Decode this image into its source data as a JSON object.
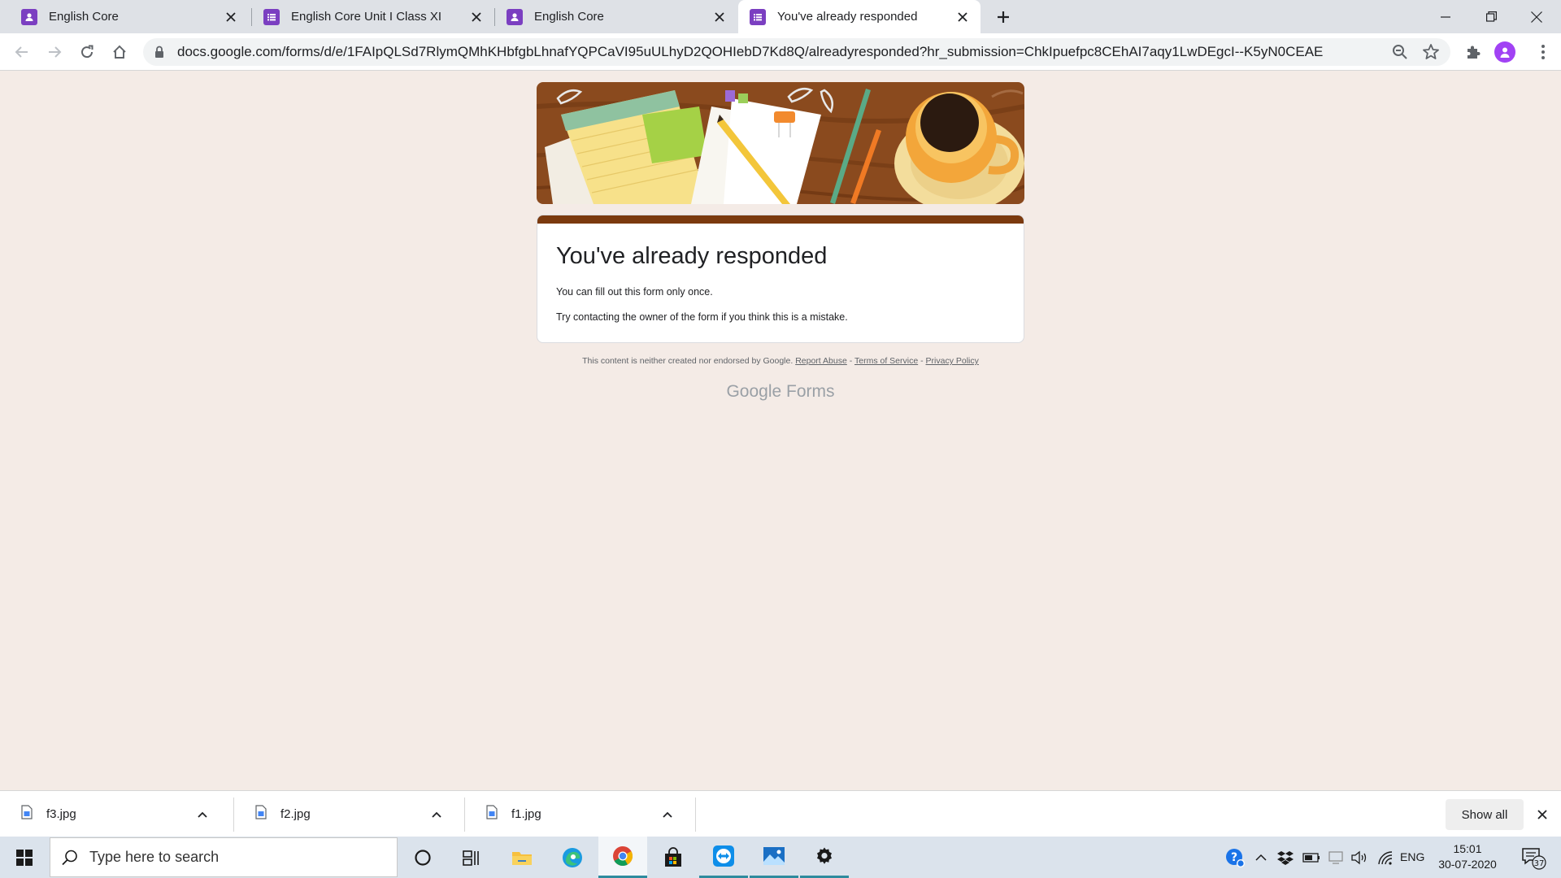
{
  "browser": {
    "tabs": [
      {
        "title": "English Core",
        "icon": "google-classroom-icon"
      },
      {
        "title": "English Core Unit I Class XI",
        "icon": "google-forms-icon"
      },
      {
        "title": "English Core",
        "icon": "google-classroom-icon"
      },
      {
        "title": "You've already responded",
        "icon": "google-forms-icon",
        "active": true
      }
    ],
    "url": "docs.google.com/forms/d/e/1FAIpQLSd7RlymQMhKHbfgbLhnafYQPCaVI95uULhyD2QOHIebD7Kd8Q/alreadyresponded?hr_submission=ChkIpuefpc8CEhAI7aqy1LwDEgcI--K5yN0CEAE"
  },
  "form": {
    "heading": "You've already responded",
    "line1": "You can fill out this form only once.",
    "line2": "Try contacting the owner of the form if you think this is a mistake.",
    "accent_color": "#7b3a0e"
  },
  "footer": {
    "disclaimer": "This content is neither created nor endorsed by Google.",
    "report_abuse": "Report Abuse",
    "sep": " - ",
    "terms": "Terms of Service",
    "privacy": "Privacy Policy",
    "brand_google": "Google",
    "brand_forms": "Forms"
  },
  "downloads": {
    "items": [
      {
        "name": "f3.jpg"
      },
      {
        "name": "f2.jpg"
      },
      {
        "name": "f1.jpg"
      }
    ],
    "show_all": "Show all"
  },
  "taskbar": {
    "search_placeholder": "Type here to search",
    "lang": "ENG",
    "time": "15:01",
    "date": "30-07-2020",
    "notification_count": "37"
  }
}
